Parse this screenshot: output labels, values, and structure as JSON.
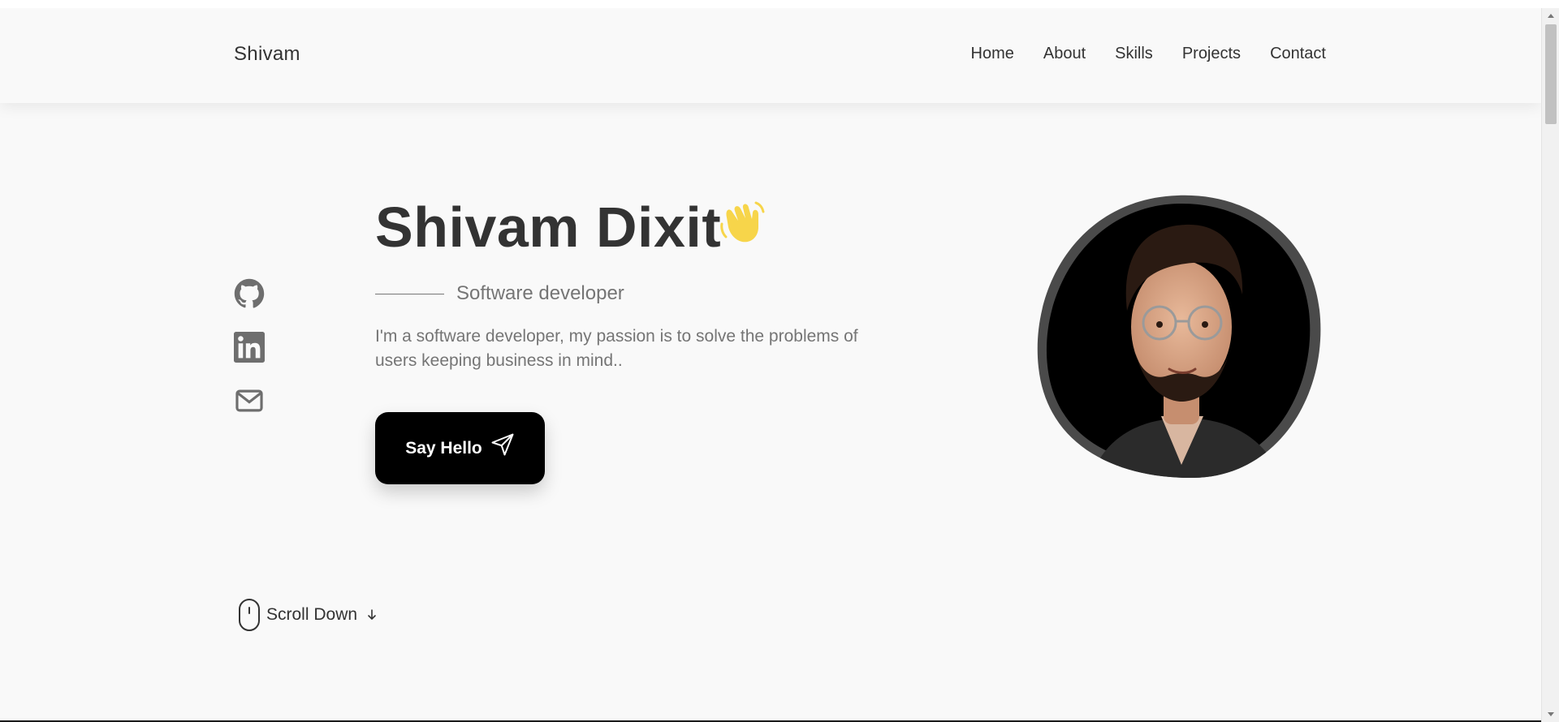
{
  "header": {
    "logo": "Shivam",
    "nav": [
      "Home",
      "About",
      "Skills",
      "Projects",
      "Contact"
    ]
  },
  "hero": {
    "title": "Shivam Dixit",
    "subtitle": "Software developer",
    "description": "I'm a software developer, my passion is to solve the problems of users keeping business in mind..",
    "cta_label": "Say Hello"
  },
  "socials": [
    "github-icon",
    "linkedin-icon",
    "mail-icon"
  ],
  "scroll": {
    "label": "Scroll Down"
  },
  "colors": {
    "background": "#f9f9f9",
    "text": "#333333",
    "muted": "#757575",
    "button": "#000000",
    "wave": "#f7d54a",
    "avatar_border": "#4a4a4a"
  }
}
